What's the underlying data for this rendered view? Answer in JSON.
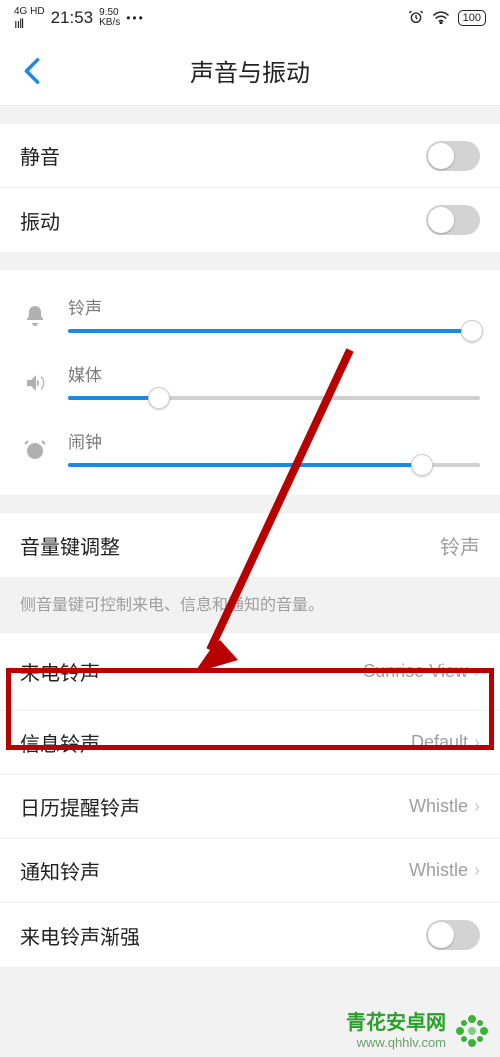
{
  "status": {
    "net": "4G HD",
    "time": "21:53",
    "speed_top": "9.50",
    "speed_bot": "KB/s",
    "battery": "100"
  },
  "header": {
    "title": "声音与振动"
  },
  "mute": {
    "label": "静音"
  },
  "vibrate": {
    "label": "振动"
  },
  "sliders": {
    "ringtone": {
      "label": "铃声",
      "pct": 98
    },
    "media": {
      "label": "媒体",
      "pct": 22
    },
    "alarm": {
      "label": "闹钟",
      "pct": 86
    }
  },
  "volkey": {
    "label": "音量键调整",
    "value": "铃声"
  },
  "volkey_hint": "侧音量键可控制来电、信息和通知的音量。",
  "ringtones": {
    "call": {
      "label": "来电铃声",
      "value": "Sunrise View"
    },
    "msg": {
      "label": "信息铃声",
      "value": "Default"
    },
    "cal": {
      "label": "日历提醒铃声",
      "value": "Whistle"
    },
    "notif": {
      "label": "通知铃声",
      "value": "Whistle"
    },
    "fadein": {
      "label": "来电铃声渐强"
    }
  },
  "watermark": {
    "name": "青花安卓网",
    "url": "www.qhhlv.com"
  }
}
